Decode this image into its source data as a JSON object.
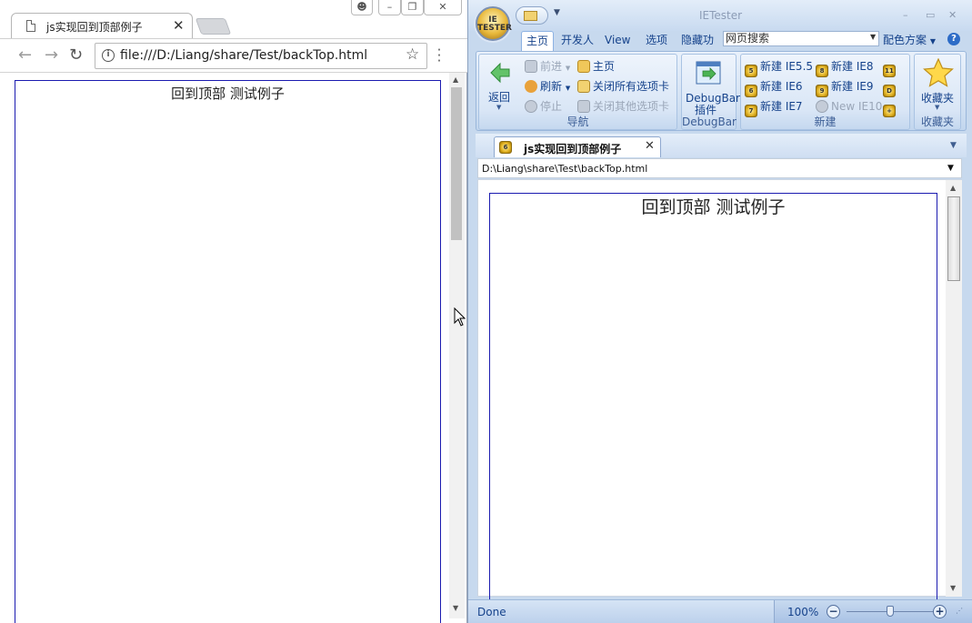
{
  "chrome": {
    "tab_title": "js实现回到顶部例子",
    "tab_close": "✕",
    "url": "file:///D:/Liang/share/Test/backTop.html",
    "page_heading": "回到顶部 测试例子"
  },
  "ietester": {
    "app_title": "IETester",
    "orb_text": "IE TESTER",
    "ribbon_tabs": [
      "主页",
      "开发人",
      "View",
      "选项",
      "隐藏功"
    ],
    "search_placeholder": "网页搜索",
    "color_scheme": "配色方案",
    "nav": {
      "back": "返回",
      "forward": "前进",
      "refresh": "刷新",
      "stop": "停止",
      "home": "主页",
      "close_all": "关闭所有选项卡",
      "close_others": "关闭其他选项卡",
      "group_label": "导航"
    },
    "debugbar": {
      "label_line1": "DebugBar",
      "label_line2": "插件",
      "group_label": "DebugBar"
    },
    "new": {
      "items": [
        {
          "label": "新建 IE5.5",
          "badge": "5"
        },
        {
          "label": "新建 IE8",
          "badge": "8"
        },
        {
          "label": "新建 IE6",
          "badge": "6"
        },
        {
          "label": "新建 IE9",
          "badge": "9"
        },
        {
          "label": "新建 IE7",
          "badge": "7"
        },
        {
          "label": "New IE10",
          "badge": ""
        }
      ],
      "extra_badges": [
        "11",
        "D",
        "+"
      ],
      "group_label": "新建"
    },
    "favorites": {
      "label": "收藏夹",
      "group_label": "收藏夹"
    },
    "doc_tab": {
      "badge": "6",
      "title": "js实现回到顶部例子",
      "close": "✕"
    },
    "address": "D:\\Liang\\share\\Test\\backTop.html",
    "page_heading": "回到顶部  测试例子",
    "status": "Done",
    "zoom": "100%",
    "zoom_level": 0.5
  }
}
